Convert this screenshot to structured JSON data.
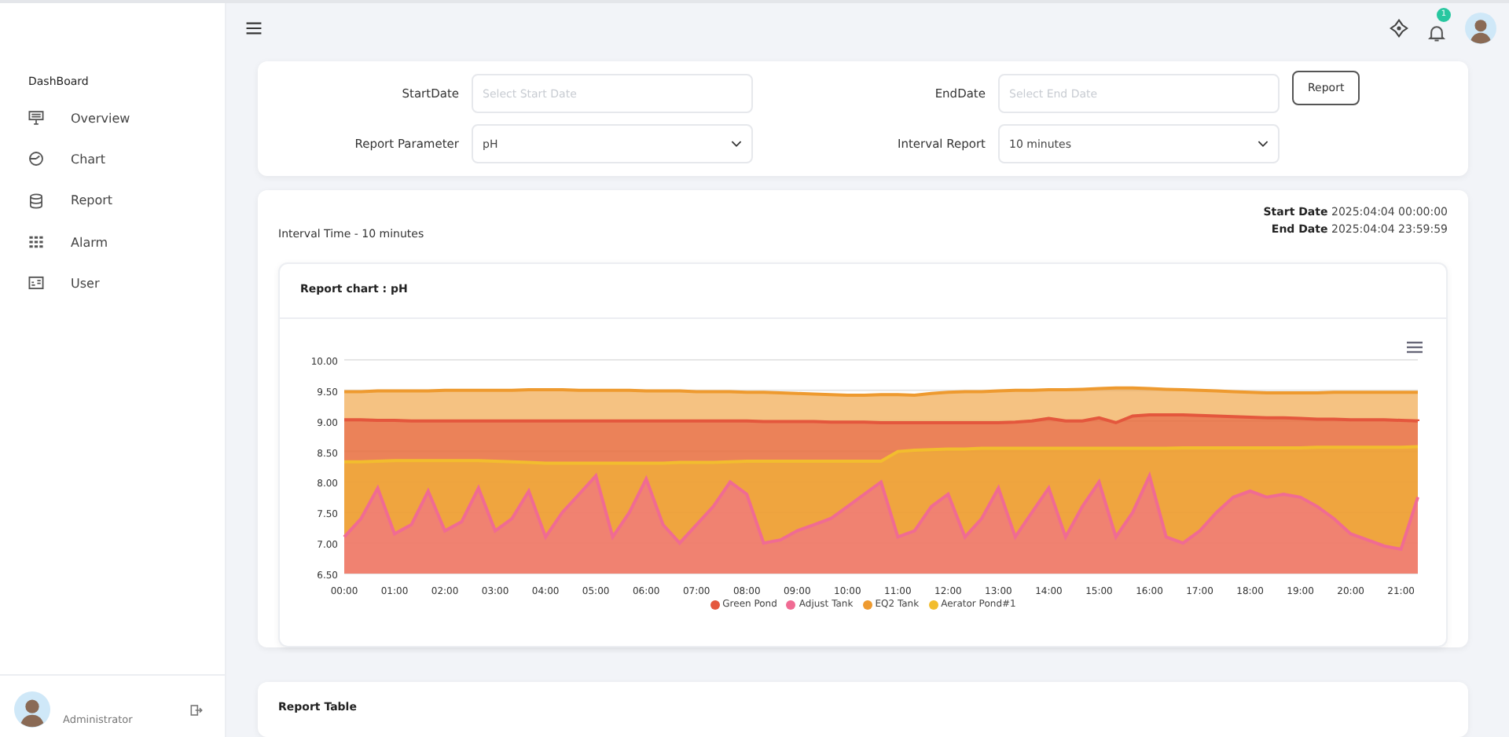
{
  "sidebar": {
    "section_title": "DashBoard",
    "items": [
      {
        "label": "Overview"
      },
      {
        "label": "Chart"
      },
      {
        "label": "Report"
      },
      {
        "label": "Alarm"
      },
      {
        "label": "User"
      }
    ],
    "user": {
      "role": "Administrator"
    }
  },
  "topbar": {
    "notification_count": "1"
  },
  "filters": {
    "start_date": {
      "label": "StartDate",
      "placeholder": "Select Start Date"
    },
    "end_date": {
      "label": "EndDate",
      "placeholder": "Select End Date"
    },
    "report_parameter": {
      "label": "Report Parameter",
      "value": "pH"
    },
    "interval_report": {
      "label": "Interval Report",
      "value": "10 minutes"
    },
    "button": "Report"
  },
  "summary": {
    "interval": "Interval Time - 10 minutes",
    "start_label": "Start Date",
    "start_value": "2025:04:04 00:00:00",
    "end_label": "End Date",
    "end_value": "2025:04:04 23:59:59"
  },
  "chart_card": {
    "title": "Report chart : pH",
    "chart_data": {
      "type": "area",
      "stacked": false,
      "grid": true,
      "legend": true,
      "x": [
        0,
        20,
        40,
        60,
        80,
        100,
        120,
        140,
        160,
        180,
        200,
        220,
        240,
        260,
        280,
        300,
        320,
        340,
        360,
        380,
        400,
        420,
        440,
        460,
        480,
        500,
        520,
        540,
        560,
        580,
        600,
        620,
        640,
        660,
        680,
        700,
        720,
        740,
        760,
        780,
        800,
        820,
        840,
        860,
        880,
        900,
        920,
        940,
        960,
        980,
        1000,
        1020,
        1040,
        1060,
        1080,
        1100,
        1120,
        1140,
        1160,
        1180,
        1200,
        1220,
        1240,
        1260,
        1280
      ],
      "xlim": [
        0,
        1280
      ],
      "xticks": [
        {
          "value": 0,
          "label": "00:00"
        },
        {
          "value": 60,
          "label": "01:00"
        },
        {
          "value": 120,
          "label": "02:00"
        },
        {
          "value": 180,
          "label": "03:00"
        },
        {
          "value": 240,
          "label": "04:00"
        },
        {
          "value": 300,
          "label": "05:00"
        },
        {
          "value": 360,
          "label": "06:00"
        },
        {
          "value": 420,
          "label": "07:00"
        },
        {
          "value": 480,
          "label": "08:00"
        },
        {
          "value": 540,
          "label": "09:00"
        },
        {
          "value": 600,
          "label": "10:00"
        },
        {
          "value": 660,
          "label": "11:00"
        },
        {
          "value": 720,
          "label": "12:00"
        },
        {
          "value": 780,
          "label": "13:00"
        },
        {
          "value": 840,
          "label": "14:00"
        },
        {
          "value": 900,
          "label": "15:00"
        },
        {
          "value": 960,
          "label": "16:00"
        },
        {
          "value": 1020,
          "label": "17:00"
        },
        {
          "value": 1080,
          "label": "18:00"
        },
        {
          "value": 1140,
          "label": "19:00"
        },
        {
          "value": 1200,
          "label": "20:00"
        },
        {
          "value": 1260,
          "label": "21:00"
        }
      ],
      "ylim": [
        6.5,
        10
      ],
      "yticks": [
        {
          "value": 6.5,
          "label": "6.50"
        },
        {
          "value": 7,
          "label": "7.00"
        },
        {
          "value": 7.5,
          "label": "7.50"
        },
        {
          "value": 8,
          "label": "8.00"
        },
        {
          "value": 8.5,
          "label": "8.50"
        },
        {
          "value": 9,
          "label": "9.00"
        },
        {
          "value": 9.5,
          "label": "9.50"
        },
        {
          "value": 10,
          "label": "10.00"
        }
      ],
      "series": [
        {
          "name": "Green Pond",
          "color": "#e4573d",
          "values": [
            9.02,
            9.02,
            9.01,
            9.01,
            9.0,
            9.0,
            9.0,
            9.0,
            9.0,
            9.0,
            9.0,
            9.0,
            9.0,
            9.0,
            9.0,
            9.0,
            9.0,
            9.0,
            9.0,
            9.0,
            9.0,
            9.0,
            9.0,
            9.0,
            9.0,
            8.99,
            8.99,
            8.99,
            8.99,
            8.98,
            8.98,
            8.98,
            8.97,
            8.97,
            8.97,
            8.97,
            8.97,
            8.97,
            8.97,
            8.97,
            8.98,
            9.0,
            9.04,
            9.0,
            9.0,
            9.05,
            8.97,
            9.08,
            9.1,
            9.1,
            9.1,
            9.09,
            9.08,
            9.07,
            9.06,
            9.05,
            9.05,
            9.04,
            9.03,
            9.03,
            9.02,
            9.02,
            9.02,
            9.01,
            9.0
          ]
        },
        {
          "name": "Adjust Tank",
          "color": "#f06b93",
          "values": [
            7.1,
            7.4,
            7.9,
            7.15,
            7.3,
            7.85,
            7.2,
            7.35,
            7.9,
            7.2,
            7.4,
            7.85,
            7.1,
            7.5,
            7.8,
            8.1,
            7.1,
            7.5,
            8.05,
            7.3,
            7.0,
            7.3,
            7.6,
            8.0,
            7.8,
            7.0,
            7.05,
            7.2,
            7.3,
            7.4,
            7.6,
            7.8,
            8.0,
            7.1,
            7.2,
            7.6,
            7.8,
            7.1,
            7.4,
            7.9,
            7.1,
            7.5,
            7.9,
            7.1,
            7.6,
            8.0,
            7.1,
            7.5,
            8.1,
            7.1,
            7.0,
            7.2,
            7.5,
            7.75,
            7.85,
            7.75,
            7.8,
            7.75,
            7.6,
            7.4,
            7.15,
            7.05,
            6.95,
            6.9,
            7.75
          ]
        },
        {
          "name": "EQ2 Tank",
          "color": "#ee9a2f",
          "values": [
            9.48,
            9.48,
            9.49,
            9.49,
            9.49,
            9.49,
            9.5,
            9.5,
            9.5,
            9.5,
            9.5,
            9.51,
            9.51,
            9.51,
            9.5,
            9.5,
            9.5,
            9.5,
            9.49,
            9.49,
            9.49,
            9.48,
            9.48,
            9.48,
            9.47,
            9.47,
            9.46,
            9.45,
            9.44,
            9.43,
            9.42,
            9.42,
            9.43,
            9.43,
            9.42,
            9.45,
            9.47,
            9.48,
            9.48,
            9.49,
            9.5,
            9.5,
            9.51,
            9.51,
            9.52,
            9.53,
            9.54,
            9.54,
            9.53,
            9.52,
            9.51,
            9.5,
            9.49,
            9.48,
            9.47,
            9.46,
            9.46,
            9.46,
            9.46,
            9.47,
            9.47,
            9.47,
            9.47,
            9.47,
            9.47
          ]
        },
        {
          "name": "Aerator Pond#1",
          "color": "#f2bd2e",
          "values": [
            8.33,
            8.33,
            8.34,
            8.35,
            8.35,
            8.35,
            8.35,
            8.35,
            8.35,
            8.34,
            8.33,
            8.32,
            8.31,
            8.31,
            8.31,
            8.31,
            8.31,
            8.31,
            8.31,
            8.31,
            8.32,
            8.32,
            8.32,
            8.33,
            8.34,
            8.34,
            8.34,
            8.34,
            8.34,
            8.34,
            8.34,
            8.34,
            8.34,
            8.5,
            8.52,
            8.53,
            8.54,
            8.54,
            8.55,
            8.55,
            8.55,
            8.55,
            8.55,
            8.55,
            8.55,
            8.55,
            8.55,
            8.55,
            8.55,
            8.55,
            8.56,
            8.56,
            8.56,
            8.56,
            8.56,
            8.56,
            8.56,
            8.56,
            8.57,
            8.57,
            8.57,
            8.57,
            8.57,
            8.57,
            8.58
          ]
        }
      ]
    }
  },
  "table_card": {
    "title": "Report Table"
  }
}
